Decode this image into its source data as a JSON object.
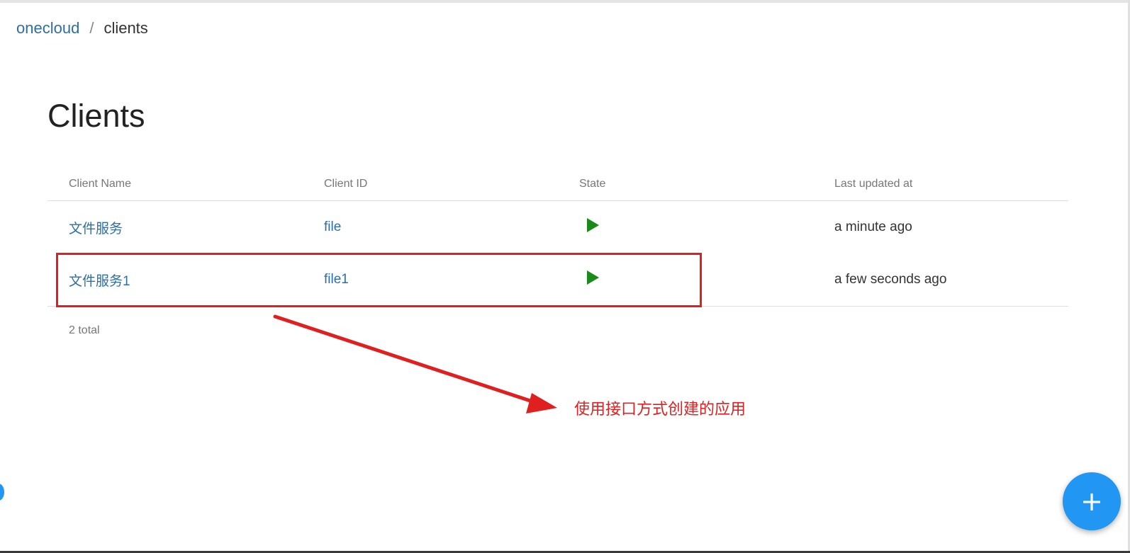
{
  "breadcrumb": {
    "root": "onecloud",
    "separator": "/",
    "current": "clients"
  },
  "page_title": "Clients",
  "table": {
    "headers": [
      "Client Name",
      "Client ID",
      "State",
      "Last updated at"
    ],
    "rows": [
      {
        "name": "文件服务",
        "client_id": "file",
        "state_icon": "play-icon",
        "updated": "a minute ago"
      },
      {
        "name": "文件服务1",
        "client_id": "file1",
        "state_icon": "play-icon",
        "updated": "a few seconds ago"
      }
    ],
    "total": "2 total"
  },
  "annotation": {
    "text": "使用接口方式创建的应用",
    "color": "#e02020"
  },
  "fab": {
    "label": "+",
    "color": "#2196f3"
  },
  "colors": {
    "link": "#2e6ea6",
    "state_running": "#1a8a1a"
  }
}
